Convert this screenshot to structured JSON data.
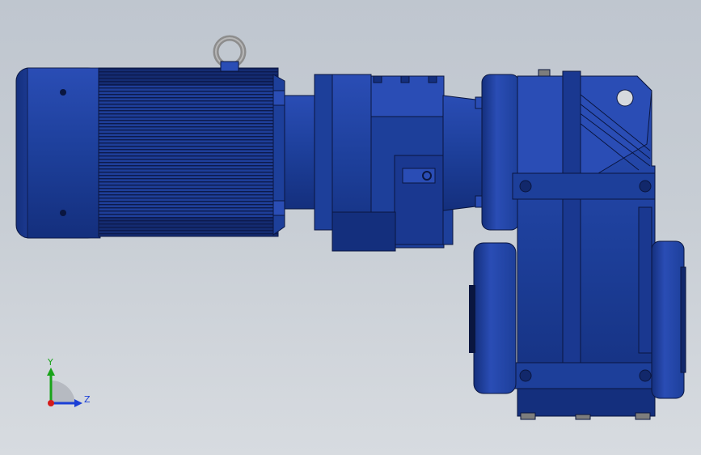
{
  "viewport": {
    "name": "3D model view",
    "background_top": "#bfc6cf",
    "background_bottom": "#d7dbe0"
  },
  "model": {
    "body_color": "#1d3f9a",
    "body_dark": "#12286b",
    "body_light": "#3458c0",
    "edge_color": "#0a1640",
    "lifting_eye_color": "#9a9a9a"
  },
  "triad": {
    "y_label": "Y",
    "z_label": "Z",
    "y_color": "#19a319",
    "z_color": "#1b3fd6",
    "x_color": "#d41b1b"
  }
}
